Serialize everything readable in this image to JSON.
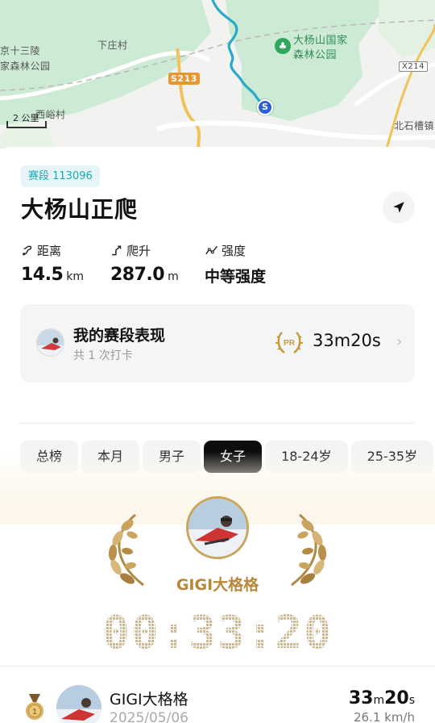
{
  "map": {
    "places": {
      "ming_tombs": "京十三陵",
      "ming_tombs_park": "家森林公园",
      "xiazhuang": "下庄村",
      "park_name_1": "大杨山国家",
      "park_name_2": "森林公园",
      "xiyu": "西峪村",
      "beishicao": "北石槽镇"
    },
    "road_s213": "S213",
    "road_x214": "X214",
    "scale": "2 公里",
    "start_marker": "S"
  },
  "segment": {
    "tag": "赛段 113096",
    "title": "大杨山正爬"
  },
  "stats": [
    {
      "label": "距离",
      "value": "14.5",
      "unit": "km"
    },
    {
      "label": "爬升",
      "value": "287.0",
      "unit": "m"
    },
    {
      "label": "强度",
      "value": "中等强度"
    }
  ],
  "performance": {
    "title": "我的赛段表现",
    "subtitle": "共 1 次打卡",
    "pr_badge": "PR",
    "time": "33m20s"
  },
  "tabs": [
    {
      "label": "总榜",
      "active": false
    },
    {
      "label": "本月",
      "active": false
    },
    {
      "label": "男子",
      "active": false
    },
    {
      "label": "女子",
      "active": true
    },
    {
      "label": "18-24岁",
      "active": false
    },
    {
      "label": "25-35岁",
      "active": false
    }
  ],
  "winner": {
    "name": "GIGI大格格",
    "big_time": "00:33:20"
  },
  "leaderboard": [
    {
      "name": "GIGI大格格",
      "date": "2025/05/06",
      "time_min": "33",
      "time_min_unit": "m",
      "time_sec": "20",
      "time_sec_unit": "s",
      "speed": "26.1 km/h"
    }
  ],
  "colors": {
    "accent_teal": "#1ba8b6",
    "gold": "#b6893a",
    "route": "#2aa9c9",
    "active_tab": "#0d0d0d"
  }
}
